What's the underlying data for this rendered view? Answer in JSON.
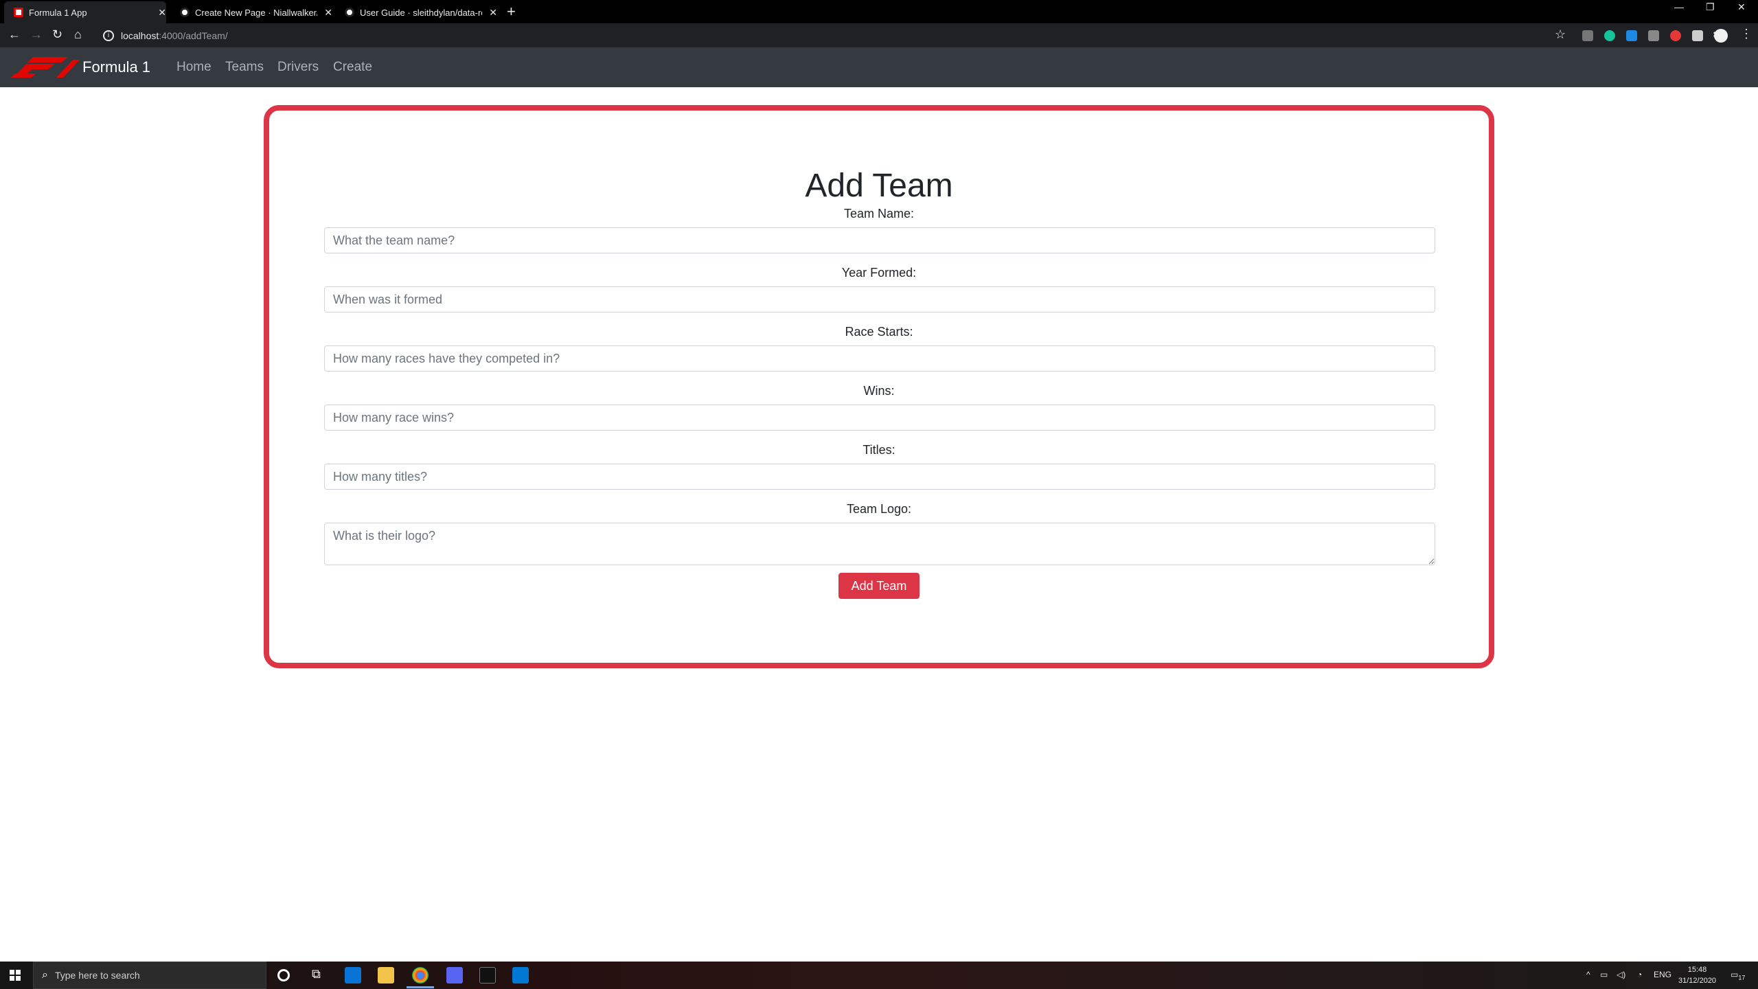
{
  "browser": {
    "tabs": [
      {
        "title": "Formula 1 App",
        "active": true
      },
      {
        "title": "Create New Page · Niallwalker/D",
        "active": false
      },
      {
        "title": "User Guide · sleithdylan/data-rep",
        "active": false
      }
    ],
    "url_host": "localhost",
    "url_path": ":4000/addTeam/"
  },
  "site": {
    "brand": "Formula 1",
    "nav": [
      "Home",
      "Teams",
      "Drivers",
      "Create"
    ]
  },
  "form": {
    "heading": "Add Team",
    "fields": [
      {
        "label": "Team Name:",
        "placeholder": "What the team name?"
      },
      {
        "label": "Year Formed:",
        "placeholder": "When was it formed"
      },
      {
        "label": "Race Starts:",
        "placeholder": "How many races have they competed in?"
      },
      {
        "label": "Wins:",
        "placeholder": "How many race wins?"
      },
      {
        "label": "Titles:",
        "placeholder": "How many titles?"
      },
      {
        "label": "Team Logo:",
        "placeholder": "What is their logo?"
      }
    ],
    "submit": "Add Team"
  },
  "taskbar": {
    "search_placeholder": "Type here to search",
    "lang": "ENG",
    "time": "15:48",
    "date": "31/12/2020",
    "notifications": "17"
  },
  "colors": {
    "accent": "#dc3545",
    "navbar": "#343a40",
    "f1_red": "#e10600"
  }
}
